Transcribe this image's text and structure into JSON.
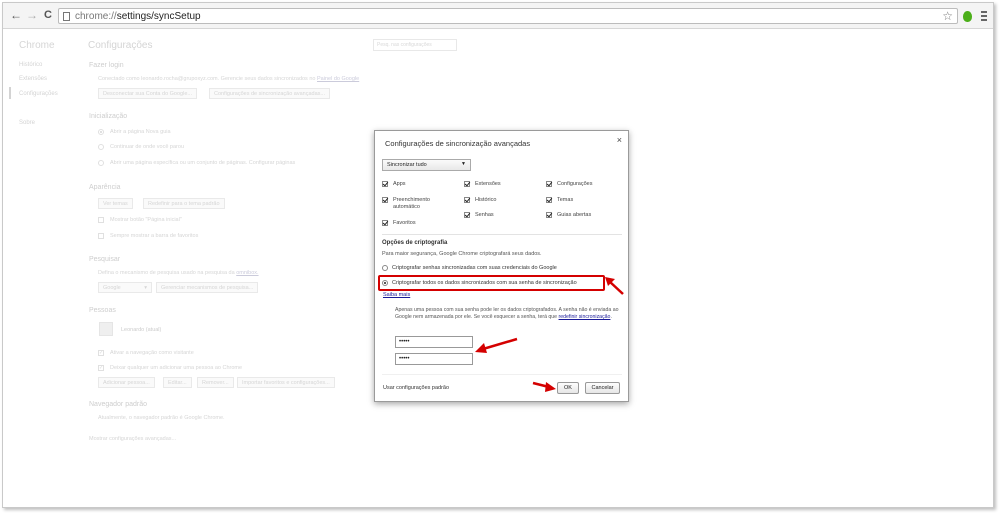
{
  "toolbar": {
    "back_label": "←",
    "forward_label": "→",
    "reload_label": "C",
    "url_host": "chrome://",
    "url_path": "settings/syncSetup"
  },
  "sidebar": {
    "brand": "Chrome",
    "items": [
      "Histórico",
      "Extensões",
      "Configurações",
      "Sobre"
    ]
  },
  "settings": {
    "title": "Configurações",
    "search_placeholder": "Pesq. nas configurações",
    "login": {
      "heading": "Fazer login",
      "text": "Conectado como leonardo.rocha@grupoxyz.com. Gerencie seus dados sincronizados no",
      "link": "Painel do Google",
      "disconnect_button": "Desconectar sua Conta do Google...",
      "advanced_button": "Configurações de sincronização avançadas..."
    },
    "startup": {
      "heading": "Inicialização",
      "option1": "Abrir a página Nova guia",
      "option2": "Continuar de onde você parou",
      "option3": "Abrir uma página específica ou um conjunto de páginas. Configurar páginas"
    },
    "appearance": {
      "heading": "Aparência",
      "themes_button": "Ver temas",
      "reset_theme_button": "Redefinir para o tema padrão",
      "home_button_label": "Mostrar botão \"Página inicial\"",
      "bookmarks_bar_label": "Sempre mostrar a barra de favoritos"
    },
    "search_section": {
      "heading": "Pesquisar",
      "text": "Defina o mecanismo de pesquisa usado na pesquisa da",
      "link": "omnibox.",
      "engine": "Google",
      "manage_button": "Gerenciar mecanismos de pesquisa..."
    },
    "people": {
      "heading": "Pessoas",
      "user": "Leonardo (atual)",
      "guest_label": "Ativar a navegação como visitante",
      "add_person_label": "Deixar qualquer um adicionar uma pessoa ao Chrome",
      "add_button": "Adicionar pessoa...",
      "edit_button": "Editar...",
      "remove_button": "Remover...",
      "import_button": "Importar favoritos e configurações..."
    },
    "default_browser": {
      "heading": "Navegador padrão",
      "text": "Atualmente, o navegador padrão é Google Chrome."
    },
    "advanced_link": "Mostrar configurações avançadas..."
  },
  "dialog": {
    "title": "Configurações de sincronização avançadas",
    "close": "×",
    "sync_select": "Sincronizar tudo",
    "checkboxes": {
      "apps": "Apps",
      "extensions": "Extensões",
      "settings": "Configurações",
      "autofill_line1": "Preenchimento",
      "autofill_line2": "automático",
      "history": "Histórico",
      "themes": "Temas",
      "passwords": "Senhas",
      "tabs": "Guias abertas",
      "bookmarks": "Favoritos"
    },
    "encryption_heading": "Opções de criptografia",
    "encryption_desc": "Para maior segurança, Google Chrome criptografará seus dados.",
    "option_google": "Criptografar senhas sincronizadas com suas credenciais do Google",
    "option_passphrase": "Criptografar todos os dados sincronizados com sua senha de sincronização",
    "learn_more": "Saiba mais",
    "info_text": "Apenas uma pessoa com sua senha pode ler os dados criptografados. A senha não é enviada ao Google nem armazenada por ele. Se você esquecer a senha, terá que",
    "info_link": "redefinir sincronização",
    "info_end": ".",
    "password1": "•••••",
    "password2": "•••••",
    "defaults_link": "Usar configurações padrão",
    "ok_button": "OK",
    "cancel_button": "Cancelar"
  },
  "colors": {
    "annotation": "#d40000",
    "link": "#1a1a99"
  }
}
